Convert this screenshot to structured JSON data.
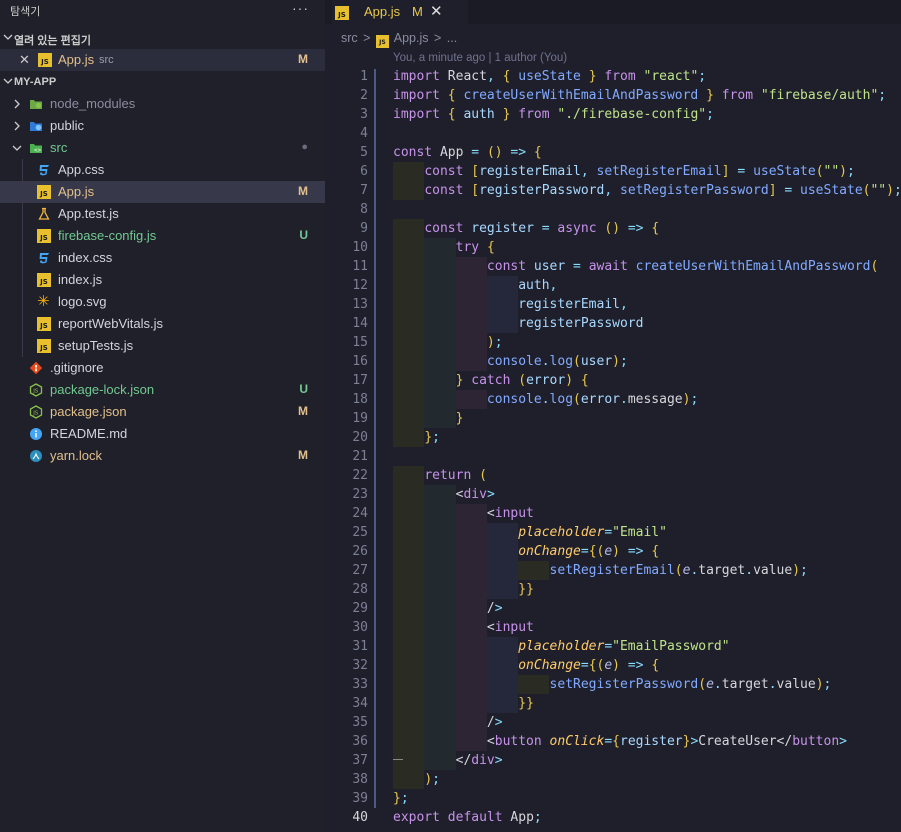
{
  "sidebar": {
    "title": "탐색기",
    "more": "···",
    "open_editors": {
      "label": "열려 있는 편집기",
      "items": [
        {
          "name": "App.js",
          "path": "src",
          "badge": "M"
        }
      ]
    },
    "project": {
      "label": "MY-APP",
      "rows": [
        {
          "name": "node_modules",
          "badge": ""
        },
        {
          "name": "public",
          "badge": ""
        },
        {
          "name": "src",
          "badge": "●"
        },
        {
          "name": "App.css",
          "badge": ""
        },
        {
          "name": "App.js",
          "badge": "M"
        },
        {
          "name": "App.test.js",
          "badge": ""
        },
        {
          "name": "firebase-config.js",
          "badge": "U"
        },
        {
          "name": "index.css",
          "badge": ""
        },
        {
          "name": "index.js",
          "badge": ""
        },
        {
          "name": "logo.svg",
          "badge": ""
        },
        {
          "name": "reportWebVitals.js",
          "badge": ""
        },
        {
          "name": "setupTests.js",
          "badge": ""
        },
        {
          "name": ".gitignore",
          "badge": ""
        },
        {
          "name": "package-lock.json",
          "badge": "U"
        },
        {
          "name": "package.json",
          "badge": "M"
        },
        {
          "name": "README.md",
          "badge": ""
        },
        {
          "name": "yarn.lock",
          "badge": "M"
        }
      ]
    }
  },
  "editor": {
    "tab": {
      "name": "App.js",
      "status": "M",
      "close": "✕"
    },
    "breadcrumb": [
      "src",
      ">",
      "App.js",
      ">",
      "..."
    ],
    "blame": "You, a minute ago | 1 author (You)",
    "line_numbers": [
      "1",
      "2",
      "3",
      "4",
      "5",
      "6",
      "7",
      "8",
      "9",
      "10",
      "11",
      "12",
      "13",
      "14",
      "15",
      "16",
      "17",
      "18",
      "19",
      "20",
      "21",
      "22",
      "23",
      "24",
      "25",
      "26",
      "27",
      "28",
      "29",
      "30",
      "31",
      "32",
      "33",
      "34",
      "35",
      "36",
      "37",
      "38",
      "39",
      "40"
    ],
    "code_lines": [
      "import React, { useState } from \"react\";",
      "import { createUserWithEmailAndPassword } from \"firebase/auth\";",
      "import { auth } from \"./firebase-config\";",
      "",
      "const App = () => {",
      "    const [registerEmail, setRegisterEmail] = useState(\"\");",
      "    const [registerPassword, setRegisterPassword] = useState(\"\");",
      "",
      "    const register = async () => {",
      "        try {",
      "            const user = await createUserWithEmailAndPassword(",
      "                auth,",
      "                registerEmail,",
      "                registerPassword",
      "            );",
      "            console.log(user);",
      "        } catch (error) {",
      "            console.log(error.message);",
      "        }",
      "    };",
      "",
      "    return (",
      "        <div>",
      "            <input",
      "                placeholder=\"Email\"",
      "                onChange={(e) => {",
      "                    setRegisterEmail(e.target.value);",
      "                }}",
      "            />",
      "            <input",
      "                placeholder=\"EmailPassword\"",
      "                onChange={(e) => {",
      "                    setRegisterPassword(e.target.value);",
      "                }}",
      "            />",
      "            <button onClick={register}>CreateUser</button>",
      "        </div>",
      "    );",
      "};",
      "export default App;"
    ]
  },
  "colors": {
    "modified": "#e2c08d",
    "untracked": "#73c991",
    "js_icon": "#e8c02e",
    "css_icon": "#42a5f5"
  }
}
